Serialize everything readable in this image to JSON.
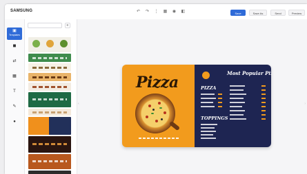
{
  "app": {
    "brand": "SAMSUNG"
  },
  "toolbar": {
    "icons": [
      "undo-icon",
      "redo-icon",
      "align-icon",
      "grid-icon",
      "layers-icon",
      "view-icon"
    ],
    "glyphs": [
      "↶",
      "↷",
      "⋮",
      "▦",
      "◉",
      "◧"
    ],
    "buttons": [
      {
        "label": "Save",
        "primary": true
      },
      {
        "label": "Save As",
        "primary": false
      },
      {
        "label": "Send",
        "primary": false
      },
      {
        "label": "Preview",
        "primary": false
      }
    ]
  },
  "rail": {
    "items": [
      {
        "label": "Templates",
        "icon": "templates-icon",
        "glyph": "▣",
        "active": true
      },
      {
        "label": "",
        "icon": "media-icon",
        "glyph": "◼",
        "active": false
      },
      {
        "label": "",
        "icon": "widgets-icon",
        "glyph": "⇄",
        "active": false
      },
      {
        "label": "",
        "icon": "shapes-icon",
        "glyph": "▦",
        "active": false
      },
      {
        "label": "",
        "icon": "text-icon",
        "glyph": "T",
        "active": false
      },
      {
        "label": "",
        "icon": "elements-icon",
        "glyph": "✎",
        "active": false
      },
      {
        "label": "",
        "icon": "more-icon",
        "glyph": "●",
        "active": false
      }
    ]
  },
  "panel": {
    "search_placeholder": "",
    "section_label": "",
    "filter_glyph": "≡"
  },
  "menu": {
    "restaurant": "",
    "title": "Pizza",
    "headline": "Most Popular Pizza",
    "subhead": "",
    "section1": "PIZZA",
    "section2": "TOPPINGS",
    "colors": {
      "orange": "#f29b1d",
      "navy": "#1e2552"
    }
  }
}
